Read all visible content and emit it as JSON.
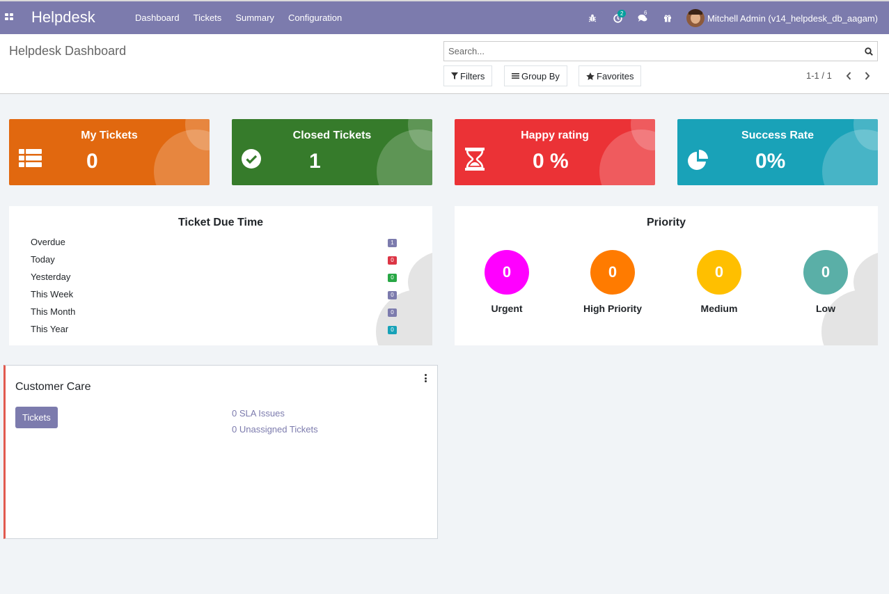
{
  "navbar": {
    "brand": "Helpdesk",
    "menu": [
      "Dashboard",
      "Tickets",
      "Summary",
      "Configuration"
    ],
    "activity_count": "2",
    "messages_count": "6",
    "user": "Mitchell Admin (v14_helpdesk_db_aagam)"
  },
  "control_panel": {
    "title": "Helpdesk Dashboard",
    "search_placeholder": "Search...",
    "filters_label": "Filters",
    "group_by_label": "Group By",
    "favorites_label": "Favorites",
    "pager": "1-1 / 1"
  },
  "stats": [
    {
      "title": "My Tickets",
      "value": "0",
      "color": "#e1680f"
    },
    {
      "title": "Closed Tickets",
      "value": "1",
      "color": "#367b2b"
    },
    {
      "title": "Happy rating",
      "value": "0 %",
      "color": "#eb3236"
    },
    {
      "title": "Success Rate",
      "value": "0%",
      "color": "#19a2b8"
    }
  ],
  "due_time": {
    "title": "Ticket Due Time",
    "rows": [
      {
        "label": "Overdue",
        "count": "1",
        "color": "#7c7bad"
      },
      {
        "label": "Today",
        "count": "0",
        "color": "#dc3545"
      },
      {
        "label": "Yesterday",
        "count": "0",
        "color": "#28a745"
      },
      {
        "label": "This Week",
        "count": "0",
        "color": "#7c7bad"
      },
      {
        "label": "This Month",
        "count": "0",
        "color": "#7c7bad"
      },
      {
        "label": "This Year",
        "count": "0",
        "color": "#17a2b8"
      }
    ]
  },
  "priority": {
    "title": "Priority",
    "items": [
      {
        "label": "Urgent",
        "count": "0",
        "color": "#ff00ff"
      },
      {
        "label": "High Priority",
        "count": "0",
        "color": "#ff7b00"
      },
      {
        "label": "Medium",
        "count": "0",
        "color": "#ffbf00"
      },
      {
        "label": "Low",
        "count": "0",
        "color": "#5aafa7"
      }
    ]
  },
  "team": {
    "name": "Customer Care",
    "tickets_button": "Tickets",
    "sla_issues": "0 SLA Issues",
    "unassigned": "0 Unassigned Tickets"
  }
}
